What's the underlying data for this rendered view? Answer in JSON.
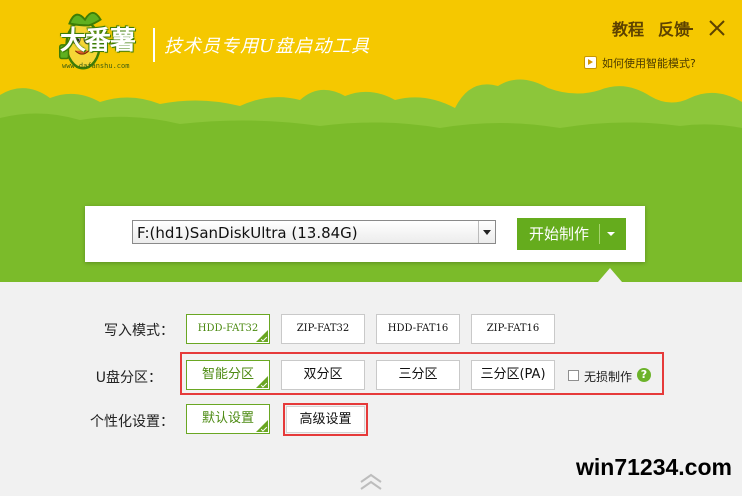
{
  "header": {
    "brand_name": "大番薯",
    "site_url": "www.dafanshu.com",
    "slogan": "技术员专用U盘启动工具",
    "link_tutorial": "教程",
    "link_feedback": "反馈",
    "howto_text": "如何使用智能模式?"
  },
  "drive": {
    "selected": "F:(hd1)SanDiskUltra (13.84G)",
    "start_button": "开始制作"
  },
  "write_mode": {
    "label": "写入模式：",
    "options": [
      "HDD-FAT32",
      "ZIP-FAT32",
      "HDD-FAT16",
      "ZIP-FAT16"
    ],
    "selected": "HDD-FAT32"
  },
  "partition": {
    "label": "U盘分区：",
    "options": [
      "智能分区",
      "双分区",
      "三分区",
      "三分区(PA)"
    ],
    "selected": "智能分区",
    "lossless_label": "无损制作",
    "lossless_checked": false,
    "help_glyph": "?"
  },
  "personalize": {
    "label": "个性化设置：",
    "options": [
      "默认设置",
      "高级设置"
    ],
    "selected": "默认设置"
  },
  "watermark": "win71234.com",
  "colors": {
    "header_yellow": "#f5c800",
    "grass_green": "#7bbb2a",
    "accent_green": "#65ac1d",
    "highlight_red": "#e63a3a"
  }
}
